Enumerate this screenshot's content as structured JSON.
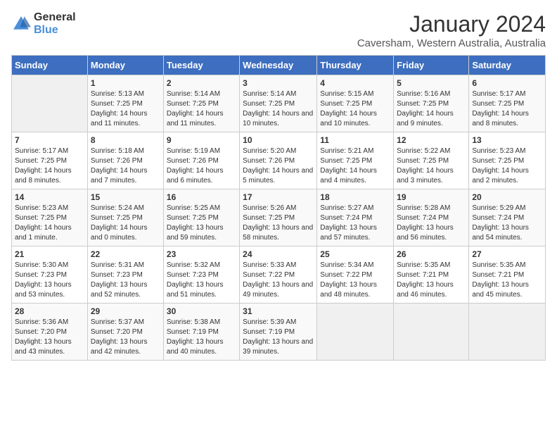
{
  "logo": {
    "text_general": "General",
    "text_blue": "Blue"
  },
  "calendar": {
    "title": "January 2024",
    "subtitle": "Caversham, Western Australia, Australia"
  },
  "headers": [
    "Sunday",
    "Monday",
    "Tuesday",
    "Wednesday",
    "Thursday",
    "Friday",
    "Saturday"
  ],
  "weeks": [
    [
      {
        "day": "",
        "sunrise": "",
        "sunset": "",
        "daylight": ""
      },
      {
        "day": "1",
        "sunrise": "Sunrise: 5:13 AM",
        "sunset": "Sunset: 7:25 PM",
        "daylight": "Daylight: 14 hours and 11 minutes."
      },
      {
        "day": "2",
        "sunrise": "Sunrise: 5:14 AM",
        "sunset": "Sunset: 7:25 PM",
        "daylight": "Daylight: 14 hours and 11 minutes."
      },
      {
        "day": "3",
        "sunrise": "Sunrise: 5:14 AM",
        "sunset": "Sunset: 7:25 PM",
        "daylight": "Daylight: 14 hours and 10 minutes."
      },
      {
        "day": "4",
        "sunrise": "Sunrise: 5:15 AM",
        "sunset": "Sunset: 7:25 PM",
        "daylight": "Daylight: 14 hours and 10 minutes."
      },
      {
        "day": "5",
        "sunrise": "Sunrise: 5:16 AM",
        "sunset": "Sunset: 7:25 PM",
        "daylight": "Daylight: 14 hours and 9 minutes."
      },
      {
        "day": "6",
        "sunrise": "Sunrise: 5:17 AM",
        "sunset": "Sunset: 7:25 PM",
        "daylight": "Daylight: 14 hours and 8 minutes."
      }
    ],
    [
      {
        "day": "7",
        "sunrise": "Sunrise: 5:17 AM",
        "sunset": "Sunset: 7:25 PM",
        "daylight": "Daylight: 14 hours and 8 minutes."
      },
      {
        "day": "8",
        "sunrise": "Sunrise: 5:18 AM",
        "sunset": "Sunset: 7:26 PM",
        "daylight": "Daylight: 14 hours and 7 minutes."
      },
      {
        "day": "9",
        "sunrise": "Sunrise: 5:19 AM",
        "sunset": "Sunset: 7:26 PM",
        "daylight": "Daylight: 14 hours and 6 minutes."
      },
      {
        "day": "10",
        "sunrise": "Sunrise: 5:20 AM",
        "sunset": "Sunset: 7:26 PM",
        "daylight": "Daylight: 14 hours and 5 minutes."
      },
      {
        "day": "11",
        "sunrise": "Sunrise: 5:21 AM",
        "sunset": "Sunset: 7:25 PM",
        "daylight": "Daylight: 14 hours and 4 minutes."
      },
      {
        "day": "12",
        "sunrise": "Sunrise: 5:22 AM",
        "sunset": "Sunset: 7:25 PM",
        "daylight": "Daylight: 14 hours and 3 minutes."
      },
      {
        "day": "13",
        "sunrise": "Sunrise: 5:23 AM",
        "sunset": "Sunset: 7:25 PM",
        "daylight": "Daylight: 14 hours and 2 minutes."
      }
    ],
    [
      {
        "day": "14",
        "sunrise": "Sunrise: 5:23 AM",
        "sunset": "Sunset: 7:25 PM",
        "daylight": "Daylight: 14 hours and 1 minute."
      },
      {
        "day": "15",
        "sunrise": "Sunrise: 5:24 AM",
        "sunset": "Sunset: 7:25 PM",
        "daylight": "Daylight: 14 hours and 0 minutes."
      },
      {
        "day": "16",
        "sunrise": "Sunrise: 5:25 AM",
        "sunset": "Sunset: 7:25 PM",
        "daylight": "Daylight: 13 hours and 59 minutes."
      },
      {
        "day": "17",
        "sunrise": "Sunrise: 5:26 AM",
        "sunset": "Sunset: 7:25 PM",
        "daylight": "Daylight: 13 hours and 58 minutes."
      },
      {
        "day": "18",
        "sunrise": "Sunrise: 5:27 AM",
        "sunset": "Sunset: 7:24 PM",
        "daylight": "Daylight: 13 hours and 57 minutes."
      },
      {
        "day": "19",
        "sunrise": "Sunrise: 5:28 AM",
        "sunset": "Sunset: 7:24 PM",
        "daylight": "Daylight: 13 hours and 56 minutes."
      },
      {
        "day": "20",
        "sunrise": "Sunrise: 5:29 AM",
        "sunset": "Sunset: 7:24 PM",
        "daylight": "Daylight: 13 hours and 54 minutes."
      }
    ],
    [
      {
        "day": "21",
        "sunrise": "Sunrise: 5:30 AM",
        "sunset": "Sunset: 7:23 PM",
        "daylight": "Daylight: 13 hours and 53 minutes."
      },
      {
        "day": "22",
        "sunrise": "Sunrise: 5:31 AM",
        "sunset": "Sunset: 7:23 PM",
        "daylight": "Daylight: 13 hours and 52 minutes."
      },
      {
        "day": "23",
        "sunrise": "Sunrise: 5:32 AM",
        "sunset": "Sunset: 7:23 PM",
        "daylight": "Daylight: 13 hours and 51 minutes."
      },
      {
        "day": "24",
        "sunrise": "Sunrise: 5:33 AM",
        "sunset": "Sunset: 7:22 PM",
        "daylight": "Daylight: 13 hours and 49 minutes."
      },
      {
        "day": "25",
        "sunrise": "Sunrise: 5:34 AM",
        "sunset": "Sunset: 7:22 PM",
        "daylight": "Daylight: 13 hours and 48 minutes."
      },
      {
        "day": "26",
        "sunrise": "Sunrise: 5:35 AM",
        "sunset": "Sunset: 7:21 PM",
        "daylight": "Daylight: 13 hours and 46 minutes."
      },
      {
        "day": "27",
        "sunrise": "Sunrise: 5:35 AM",
        "sunset": "Sunset: 7:21 PM",
        "daylight": "Daylight: 13 hours and 45 minutes."
      }
    ],
    [
      {
        "day": "28",
        "sunrise": "Sunrise: 5:36 AM",
        "sunset": "Sunset: 7:20 PM",
        "daylight": "Daylight: 13 hours and 43 minutes."
      },
      {
        "day": "29",
        "sunrise": "Sunrise: 5:37 AM",
        "sunset": "Sunset: 7:20 PM",
        "daylight": "Daylight: 13 hours and 42 minutes."
      },
      {
        "day": "30",
        "sunrise": "Sunrise: 5:38 AM",
        "sunset": "Sunset: 7:19 PM",
        "daylight": "Daylight: 13 hours and 40 minutes."
      },
      {
        "day": "31",
        "sunrise": "Sunrise: 5:39 AM",
        "sunset": "Sunset: 7:19 PM",
        "daylight": "Daylight: 13 hours and 39 minutes."
      },
      {
        "day": "",
        "sunrise": "",
        "sunset": "",
        "daylight": ""
      },
      {
        "day": "",
        "sunrise": "",
        "sunset": "",
        "daylight": ""
      },
      {
        "day": "",
        "sunrise": "",
        "sunset": "",
        "daylight": ""
      }
    ]
  ]
}
